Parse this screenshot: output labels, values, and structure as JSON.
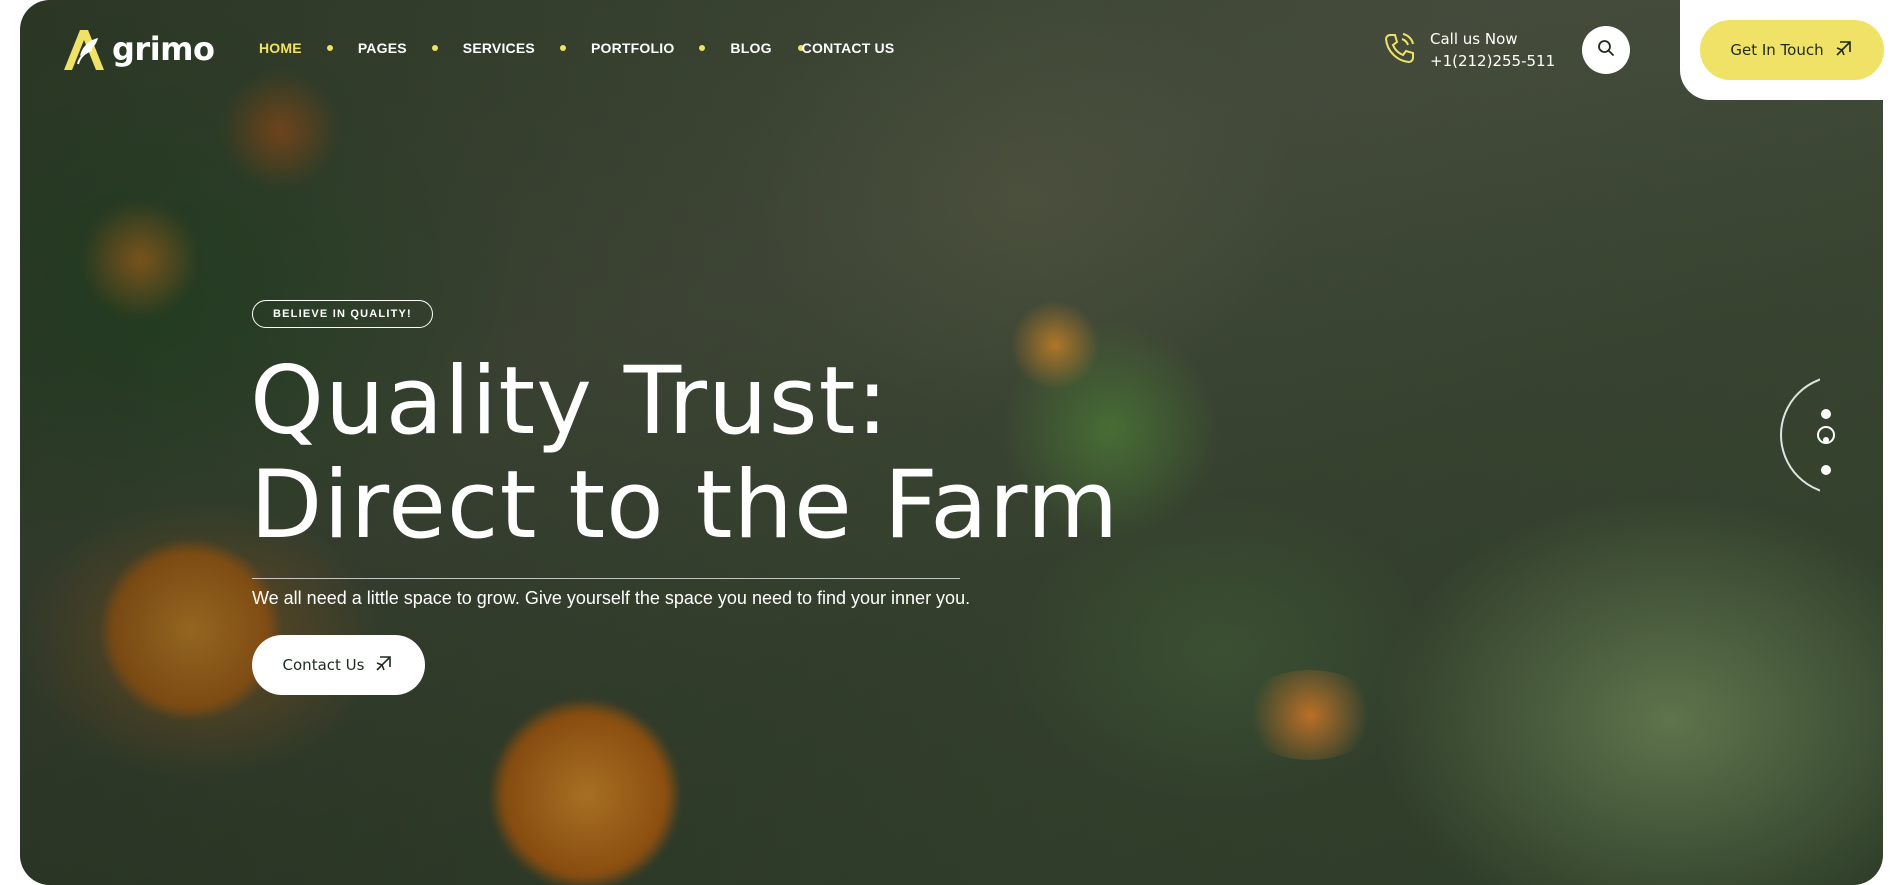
{
  "brand": {
    "name": "grimo",
    "accent": "#f0e266",
    "dark": "#1f2a1f"
  },
  "nav": {
    "items": [
      {
        "label": "HOME",
        "active": true
      },
      {
        "label": "PAGES",
        "active": false
      },
      {
        "label": "SERVICES",
        "active": false
      },
      {
        "label": "PORTFOLIO",
        "active": false
      },
      {
        "label": "BLOG",
        "active": false
      },
      {
        "label": "CONTACT US",
        "active": false
      }
    ]
  },
  "call": {
    "label": "Call us Now",
    "phone": "+1(212)255-511",
    "icon": "phone-icon"
  },
  "search": {
    "icon": "search-icon"
  },
  "header_cta": {
    "label": "Get In Touch",
    "icon": "arrow-up-right-icon"
  },
  "hero": {
    "badge": "BELIEVE IN QUALITY!",
    "headline_line1": "Quality Trust:",
    "headline_line2": "Direct to the Farm",
    "subtext": "We all need a little space to grow. Give yourself the space you need to find your inner you.",
    "cta_label": "Contact Us",
    "cta_icon": "arrow-up-right-icon"
  },
  "slider": {
    "total": 3,
    "active_index": 1
  }
}
